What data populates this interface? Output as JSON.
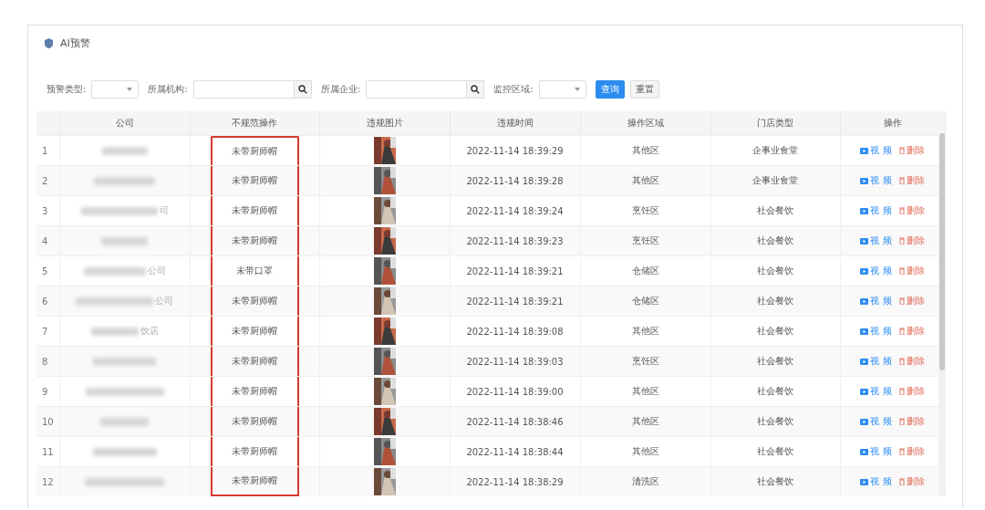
{
  "panel": {
    "title": "AI预警"
  },
  "filters": [
    {
      "kind": "select",
      "label": "预警类型:"
    },
    {
      "kind": "search",
      "label": "所属机构:"
    },
    {
      "kind": "search",
      "label": "所属企业:"
    },
    {
      "kind": "select",
      "label": "监控区域:"
    }
  ],
  "buttons": [
    {
      "label": "查询",
      "kind": "primary"
    },
    {
      "label": "重置",
      "kind": "plain"
    }
  ],
  "table": {
    "columns": [
      "公司",
      "不规范操作",
      "违规图片",
      "违规时间",
      "操作区域",
      "门店类型",
      "操作"
    ],
    "rows": [
      {
        "index": "1",
        "company_suffix": "",
        "flagged": true,
        "violation": "未带厨师帽",
        "time": "2022-11-14 18:39:29",
        "area": "其他区",
        "store_type": "企事业食堂",
        "video": "视 频",
        "delete": "删除"
      },
      {
        "index": "2",
        "company_suffix": "",
        "flagged": true,
        "violation": "未带厨师帽",
        "time": "2022-11-14 18:39:28",
        "area": "其他区",
        "store_type": "企事业食堂",
        "video": "视 频",
        "delete": "删除"
      },
      {
        "index": "3",
        "company_suffix": "司",
        "flagged": true,
        "violation": "未带厨师帽",
        "time": "2022-11-14 18:39:24",
        "area": "烹饪区",
        "store_type": "社会餐饮",
        "video": "视 频",
        "delete": "删除"
      },
      {
        "index": "4",
        "company_suffix": "",
        "flagged": true,
        "violation": "未带厨师帽",
        "time": "2022-11-14 18:39:23",
        "area": "烹饪区",
        "store_type": "社会餐饮",
        "video": "视 频",
        "delete": "删除"
      },
      {
        "index": "5",
        "company_suffix": "公司",
        "flagged": true,
        "violation": "未带口罩",
        "time": "2022-11-14 18:39:21",
        "area": "仓储区",
        "store_type": "社会餐饮",
        "video": "视 频",
        "delete": "删除"
      },
      {
        "index": "6",
        "company_suffix": "公司",
        "flagged": true,
        "violation": "未带厨师帽",
        "time": "2022-11-14 18:39:21",
        "area": "仓储区",
        "store_type": "社会餐饮",
        "video": "视 频",
        "delete": "删除"
      },
      {
        "index": "7",
        "company_suffix": "饮店",
        "flagged": true,
        "violation": "未带厨师帽",
        "time": "2022-11-14 18:39:08",
        "area": "其他区",
        "store_type": "社会餐饮",
        "video": "视 频",
        "delete": "删除"
      },
      {
        "index": "8",
        "company_suffix": "",
        "flagged": true,
        "violation": "未带厨师帽",
        "time": "2022-11-14 18:39:03",
        "area": "烹饪区",
        "store_type": "社会餐饮",
        "video": "视 频",
        "delete": "删除"
      },
      {
        "index": "9",
        "company_suffix": "",
        "flagged": true,
        "violation": "未带厨师帽",
        "time": "2022-11-14 18:39:00",
        "area": "其他区",
        "store_type": "社会餐饮",
        "video": "视 频",
        "delete": "删除"
      },
      {
        "index": "10",
        "company_suffix": "",
        "flagged": true,
        "violation": "未带厨师帽",
        "time": "2022-11-14 18:38:46",
        "area": "其他区",
        "store_type": "社会餐饮",
        "video": "视 频",
        "delete": "删除"
      },
      {
        "index": "11",
        "company_suffix": "",
        "flagged": true,
        "violation": "未带厨师帽",
        "time": "2022-11-14 18:38:44",
        "area": "其他区",
        "store_type": "社会餐饮",
        "video": "视 频",
        "delete": "删除"
      },
      {
        "index": "12",
        "company_suffix": "",
        "flagged": true,
        "violation": "未带厨师帽",
        "time": "2022-11-14 18:38:29",
        "area": "清洗区",
        "store_type": "社会餐饮",
        "video": "视 频",
        "delete": "删除"
      }
    ]
  }
}
